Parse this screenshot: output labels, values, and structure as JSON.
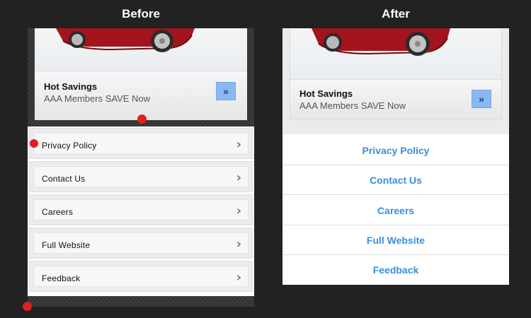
{
  "headings": {
    "before": "Before",
    "after": "After"
  },
  "ad": {
    "title": "Hot Savings",
    "subtitle": "AAA Members SAVE Now",
    "button_glyph": "»"
  },
  "menu": {
    "items": [
      {
        "label": "Privacy Policy"
      },
      {
        "label": "Contact Us"
      },
      {
        "label": "Careers"
      },
      {
        "label": "Full Website"
      },
      {
        "label": "Feedback"
      }
    ],
    "chevron": "›"
  },
  "colors": {
    "background": "#222222",
    "link": "#3a8fd8",
    "ad_button": "#8ab8f2",
    "marker": "#e02020",
    "car": "#a3141c"
  },
  "icons": [
    "car-image",
    "double-chevron-icon",
    "chevron-right-icon",
    "red-dot-marker"
  ]
}
